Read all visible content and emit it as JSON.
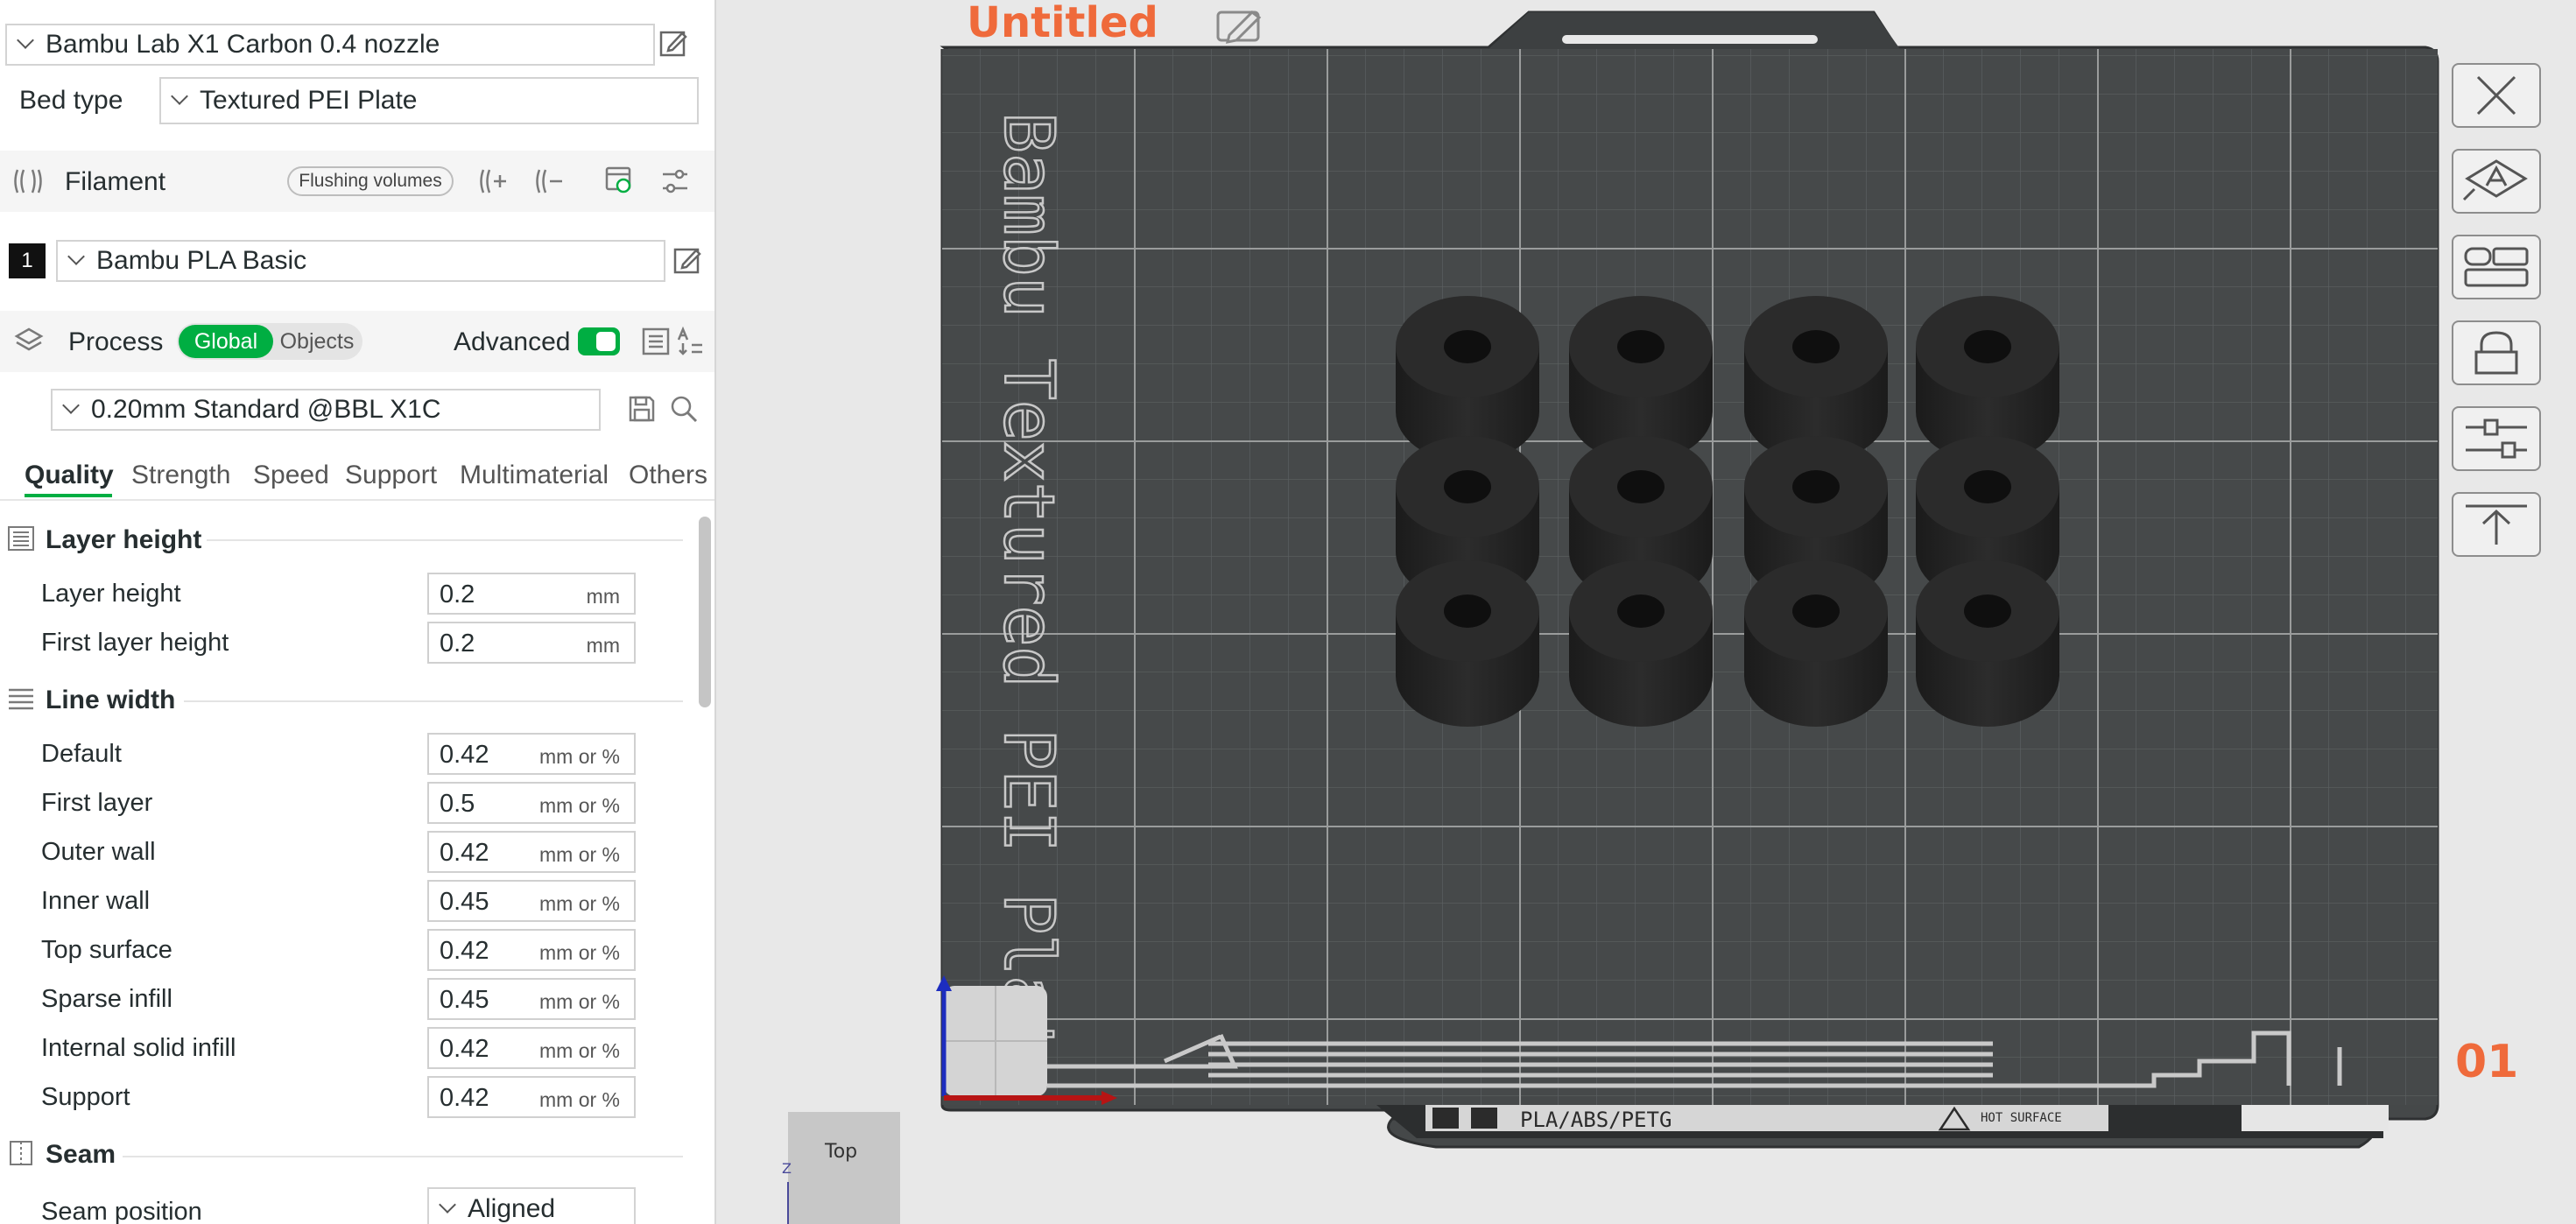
{
  "printer": {
    "name": "Bambu Lab X1 Carbon 0.4 nozzle"
  },
  "bed": {
    "label": "Bed type",
    "value": "Textured PEI Plate"
  },
  "filament": {
    "title": "Filament",
    "flushing_label": "Flushing volumes",
    "slot_number": "1",
    "slot_color": "#111111",
    "selected": "Bambu PLA Basic"
  },
  "process": {
    "title": "Process",
    "toggle": {
      "global": "Global",
      "objects": "Objects"
    },
    "advanced_label": "Advanced",
    "advanced_on": true,
    "preset": "0.20mm Standard @BBL X1C"
  },
  "tabs": [
    "Quality",
    "Strength",
    "Speed",
    "Support",
    "Multimaterial",
    "Others"
  ],
  "groups": {
    "layer_height": {
      "title": "Layer height",
      "rows": [
        {
          "label": "Layer height",
          "value": "0.2",
          "unit": "mm"
        },
        {
          "label": "First layer height",
          "value": "0.2",
          "unit": "mm"
        }
      ]
    },
    "line_width": {
      "title": "Line width",
      "rows": [
        {
          "label": "Default",
          "value": "0.42",
          "unit": "mm or %"
        },
        {
          "label": "First layer",
          "value": "0.5",
          "unit": "mm or %"
        },
        {
          "label": "Outer wall",
          "value": "0.42",
          "unit": "mm or %"
        },
        {
          "label": "Inner wall",
          "value": "0.45",
          "unit": "mm or %"
        },
        {
          "label": "Top surface",
          "value": "0.42",
          "unit": "mm or %"
        },
        {
          "label": "Sparse infill",
          "value": "0.45",
          "unit": "mm or %"
        },
        {
          "label": "Internal solid infill",
          "value": "0.42",
          "unit": "mm or %"
        },
        {
          "label": "Support",
          "value": "0.42",
          "unit": "mm or %"
        }
      ]
    },
    "seam": {
      "title": "Seam",
      "rows": [
        {
          "label": "Seam position",
          "value": "Aligned"
        }
      ]
    }
  },
  "viewport": {
    "project_title": "Untitled",
    "bed_text": "Bambu Textured PEI Plate",
    "plate_strip": "PLA/ABS/PETG",
    "hot_surface": "HOT SURFACE",
    "plate_number": "01",
    "view_label": "Top",
    "axis_z": "Z",
    "parts_rows": 3,
    "parts_cols": 4,
    "accent": "#ef6a3b",
    "brand_green": "#00ae42"
  },
  "right_toolbar": [
    "close-icon",
    "auto-orient-icon",
    "arrange-icon",
    "lock-icon",
    "settings-sliders-icon",
    "lay-on-face-icon"
  ]
}
